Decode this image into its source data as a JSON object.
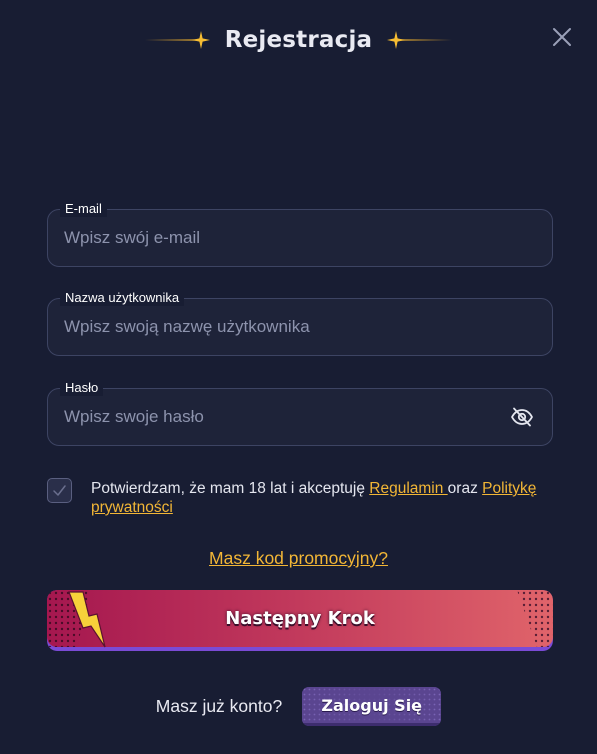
{
  "header": {
    "title": "Rejestracja"
  },
  "form": {
    "email": {
      "label": "E-mail",
      "placeholder": "Wpisz swój e-mail"
    },
    "username": {
      "label": "Nazwa użytkownika",
      "placeholder": "Wpisz swoją nazwę użytkownika"
    },
    "password": {
      "label": "Hasło",
      "placeholder": "Wpisz swoje hasło"
    }
  },
  "consent": {
    "checked": false,
    "text_before": "Potwierdzam, że mam 18 lat i akceptuję ",
    "terms_link": "Regulamin ",
    "text_middle": "oraz ",
    "privacy_link": "Politykę prywatności"
  },
  "promo": {
    "link_label": "Masz kod promocyjny?"
  },
  "next_button": {
    "label": "Następny Krok"
  },
  "login": {
    "question": "Masz już konto?",
    "button_label": "Zaloguj Się"
  },
  "icons": {
    "close": "close-icon",
    "password_toggle": "eye-slash-icon",
    "checkbox_mark": "check-icon",
    "title_decoration": "sparkle-icon"
  },
  "colors": {
    "background": "#181d33",
    "field_background": "#1e2339",
    "field_border": "#3d4463",
    "accent_link": "#f2b636",
    "button_gradient_start": "#a5174f",
    "button_gradient_end": "#e0646a",
    "button_underline": "#7a4bd6",
    "login_button": "#5a4590"
  }
}
